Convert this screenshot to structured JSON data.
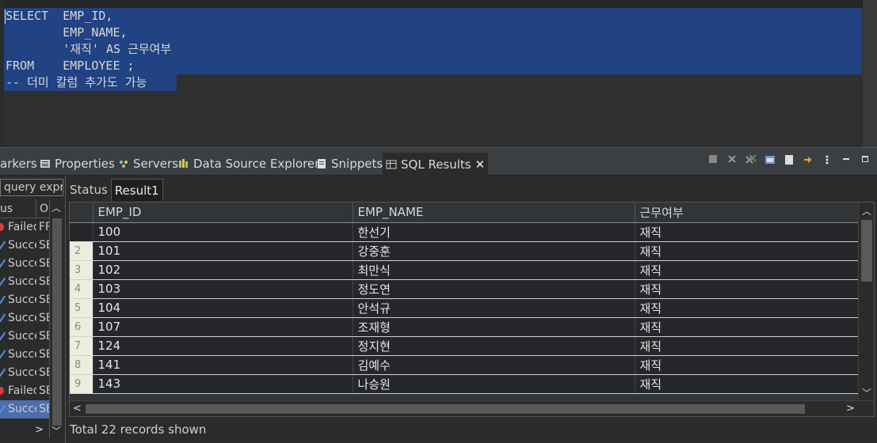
{
  "editor": {
    "lines": [
      "SELECT  EMP_ID,",
      "        EMP_NAME,",
      "        '재직' AS 근무여부",
      "FROM    EMPLOYEE ;",
      "-- 더미 칼럼 추가도 가능"
    ],
    "selection_color": "#214283"
  },
  "view_tabs": {
    "markers": "arkers",
    "properties": "Properties",
    "servers": "Servers",
    "data_source_explorer": "Data Source Explorer",
    "snippets": "Snippets",
    "sql_results": "SQL Results",
    "close": "✕"
  },
  "history": {
    "filter_placeholder": "query expr",
    "col_status": "us",
    "col_operation": "O",
    "rows": [
      {
        "status": "Failed",
        "op": "FR",
        "state": "fail"
      },
      {
        "status": "Succe",
        "op": "SE",
        "state": "ok"
      },
      {
        "status": "Succe",
        "op": "SE",
        "state": "ok"
      },
      {
        "status": "Succe",
        "op": "SE",
        "state": "ok"
      },
      {
        "status": "Succe",
        "op": "SE",
        "state": "ok"
      },
      {
        "status": "Succe",
        "op": "SE",
        "state": "ok"
      },
      {
        "status": "Succe",
        "op": "SE",
        "state": "ok"
      },
      {
        "status": "Succe",
        "op": "SE",
        "state": "ok"
      },
      {
        "status": "Succe",
        "op": "SE",
        "state": "ok"
      },
      {
        "status": "Failed",
        "op": "SE",
        "state": "fail"
      },
      {
        "status": "Succe",
        "op": "SE",
        "state": "ok",
        "selected": true
      }
    ]
  },
  "results": {
    "tab_status": "Status",
    "tab_result": "Result1",
    "columns": [
      "EMP_ID",
      "EMP_NAME",
      "근무여부"
    ],
    "rows": [
      [
        "1",
        "100",
        "한선기",
        "재직"
      ],
      [
        "2",
        "101",
        "강중훈",
        "재직"
      ],
      [
        "3",
        "102",
        "최만식",
        "재직"
      ],
      [
        "4",
        "103",
        "정도연",
        "재직"
      ],
      [
        "5",
        "104",
        "안석규",
        "재직"
      ],
      [
        "6",
        "107",
        "조재형",
        "재직"
      ],
      [
        "7",
        "124",
        "정지현",
        "재직"
      ],
      [
        "8",
        "141",
        "김예수",
        "재직"
      ],
      [
        "9",
        "143",
        "나승원",
        "재직"
      ]
    ],
    "footer": "Total 22 records shown"
  }
}
